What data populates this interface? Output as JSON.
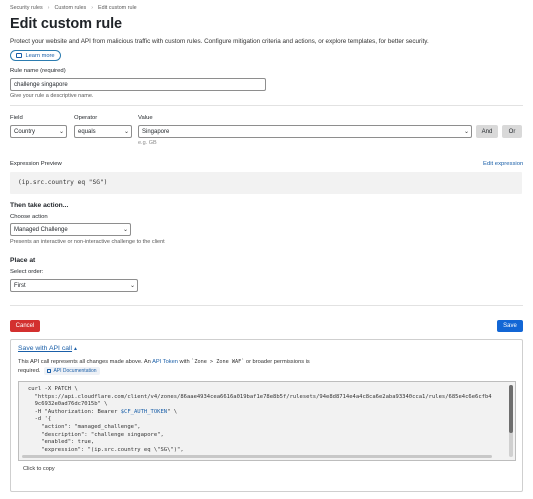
{
  "breadcrumb": [
    "Security rules",
    "Custom rules",
    "Edit custom rule"
  ],
  "page": {
    "title": "Edit custom rule",
    "description": "Protect your website and API from malicious traffic with custom rules. Configure mitigation criteria and actions, or explore templates, for better security.",
    "learn_more": "Learn more"
  },
  "rule_name": {
    "label": "Rule name (required)",
    "value": "challenge singapore",
    "help": "Give your rule a descriptive name."
  },
  "expression_builder": {
    "field_label": "Field",
    "field_value": "Country",
    "operator_label": "Operator",
    "operator_value": "equals",
    "value_label": "Value",
    "value_value": "Singapore",
    "value_hint": "e.g. GB",
    "and_label": "And",
    "or_label": "Or"
  },
  "expression_preview": {
    "label": "Expression Preview",
    "edit_link": "Edit expression",
    "expression": "(ip.src.country eq \"SG\")"
  },
  "action": {
    "heading": "Then take action...",
    "choose_label": "Choose action",
    "selected": "Managed Challenge",
    "help": "Presents an interactive or non-interactive challenge to the client"
  },
  "place": {
    "heading": "Place at",
    "order_label": "Select order:",
    "selected": "First"
  },
  "footer": {
    "cancel": "Cancel",
    "save": "Save"
  },
  "api": {
    "toggle_label": "Save with API call",
    "desc_prefix": "This API call represents all changes made above. An",
    "api_token_link": "API Token",
    "desc_with": "with",
    "permission": "`Zone > Zone WAF`",
    "desc_suffix": "or broader permissions is",
    "required": "required.",
    "doc_label": "API Documentation",
    "code": {
      "l1": "curl -X PATCH \\",
      "l2": "  \"https://api.cloudflare.com/client/v4/zones/86aae4934cea6616a019baf1e78e8b5f/rulesets/94e8d8714e4a4c8ca6e2aba93340cca1/rules/685e4c6e6cfb4",
      "l3": "  9c6932e0ad76dc7015b\" \\",
      "l4_pre": "  -H \"Authorization: Bearer ",
      "l4_var": "$CF_AUTH_TOKEN",
      "l4_post": "\" \\",
      "l5": "  -d '{",
      "l6": "    \"action\": \"managed_challenge\",",
      "l7": "    \"description\": \"challenge singapore\",",
      "l8": "    \"enabled\": true,",
      "l9": "    \"expression\": \"(ip.src.country eq \\\"SG\\\")\","
    },
    "click_to_copy": "Click to copy"
  }
}
